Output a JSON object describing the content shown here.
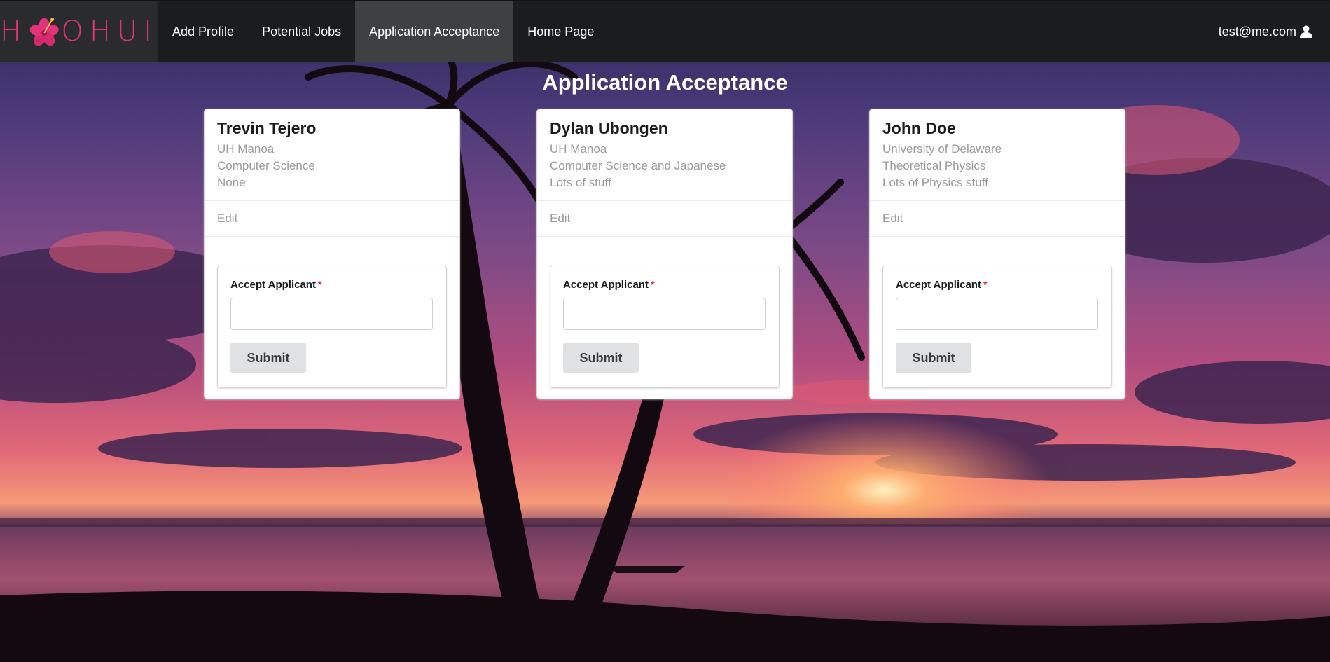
{
  "navbar": {
    "brand_before": "H",
    "brand_after": "OHUI",
    "items": [
      {
        "label": "Add Profile",
        "active": false
      },
      {
        "label": "Potential Jobs",
        "active": false
      },
      {
        "label": "Application Acceptance",
        "active": true
      },
      {
        "label": "Home Page",
        "active": false
      }
    ],
    "user_email": "test@me.com",
    "user_icon": "user-icon"
  },
  "page": {
    "title": "Application Acceptance"
  },
  "cards": [
    {
      "name": "Trevin Tejero",
      "school": "UH Manoa",
      "major": "Computer Science",
      "experience": "None",
      "edit_label": "Edit",
      "form": {
        "label": "Accept Applicant",
        "required_mark": "*",
        "value": "",
        "submit_label": "Submit"
      }
    },
    {
      "name": "Dylan Ubongen",
      "school": "UH Manoa",
      "major": "Computer Science and Japanese",
      "experience": "Lots of stuff",
      "edit_label": "Edit",
      "form": {
        "label": "Accept Applicant",
        "required_mark": "*",
        "value": "",
        "submit_label": "Submit"
      }
    },
    {
      "name": "John Doe",
      "school": "University of Delaware",
      "major": "Theoretical Physics",
      "experience": "Lots of Physics stuff",
      "edit_label": "Edit",
      "form": {
        "label": "Accept Applicant",
        "required_mark": "*",
        "value": "",
        "submit_label": "Submit"
      }
    }
  ],
  "colors": {
    "brand": "#e2337a",
    "navbar_bg": "#1b1c1d",
    "nav_active_bg": "#3f4041",
    "required": "#db2828"
  }
}
